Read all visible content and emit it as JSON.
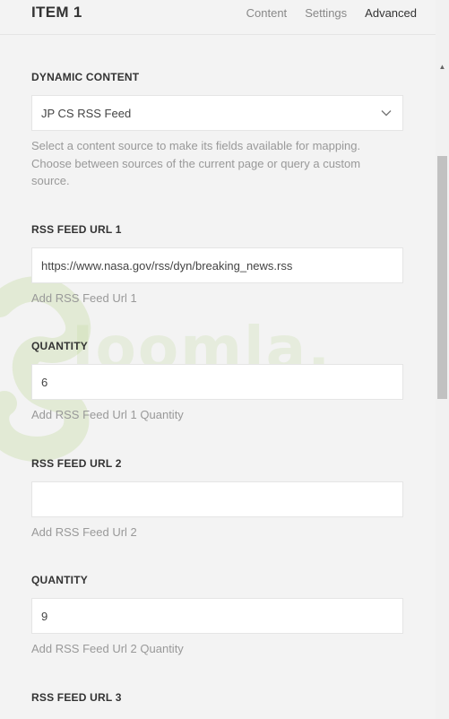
{
  "header": {
    "title": "ITEM 1",
    "tabs": [
      "Content",
      "Settings",
      "Advanced"
    ],
    "active_tab": "Advanced"
  },
  "watermark": "Joomla.",
  "fields": {
    "dynamic_content": {
      "label": "DYNAMIC CONTENT",
      "value": "JP CS RSS Feed",
      "help": "Select a content source to make its fields available for mapping. Choose between sources of the current page or query a custom source."
    },
    "rss_feed_url_1": {
      "label": "RSS FEED URL 1",
      "value": "https://www.nasa.gov/rss/dyn/breaking_news.rss",
      "help": "Add RSS Feed Url 1"
    },
    "quantity_1": {
      "label": "QUANTITY",
      "value": "6",
      "help": "Add RSS Feed Url 1 Quantity"
    },
    "rss_feed_url_2": {
      "label": "RSS FEED URL 2",
      "value": "",
      "help": "Add RSS Feed Url 2"
    },
    "quantity_2": {
      "label": "QUANTITY",
      "value": "9",
      "help": "Add RSS Feed Url 2 Quantity"
    },
    "rss_feed_url_3": {
      "label": "RSS FEED URL 3"
    }
  },
  "icons": {
    "select_chevron": "chevron-down-icon",
    "scroll_up": "scroll-up-arrow-icon",
    "scroll_down": "scroll-down-arrow-icon"
  },
  "colors": {
    "panel_background": "#f3f3f3",
    "input_background": "#ffffff",
    "input_border": "#e5e5e5",
    "label_color": "#333333",
    "help_color": "#999999",
    "inactive_tab": "#888888",
    "watermark": "#bcd691"
  }
}
